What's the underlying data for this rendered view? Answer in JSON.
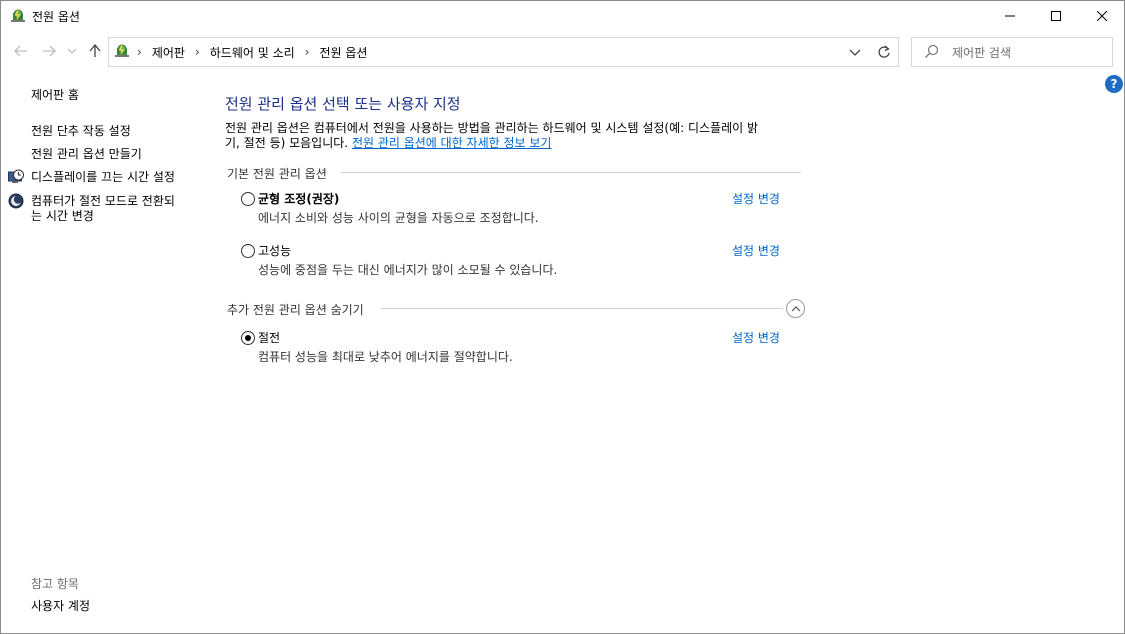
{
  "window": {
    "title": "전원 옵션"
  },
  "address_bar": {
    "crumbs": [
      "제어판",
      "하드웨어 및 소리",
      "전원 옵션"
    ]
  },
  "search": {
    "placeholder": "제어판 검색"
  },
  "help": {
    "label": "?"
  },
  "left_pane": {
    "home": "제어판 홈",
    "links": [
      "전원 단추 작동 설정",
      "전원 관리 옵션 만들기",
      "디스플레이를 끄는 시간 설정",
      "컴퓨터가 절전 모드로 전환되",
      "는 시간 변경"
    ],
    "see_also_heading": "참고 항목",
    "see_also_link": "사용자 계정"
  },
  "main": {
    "title": "전원 관리 옵션 선택 또는 사용자 지정",
    "description_line1": "전원 관리 옵션은 컴퓨터에서 전원을 사용하는 방법을 관리하는 하드웨어 및 시스템 설정(예: 디스플레이 밝",
    "description_line2_prefix": "기, 절전 등) 모음입니다. ",
    "description_link": "전원 관리 옵션에 대한 자세한 정보 보기",
    "section_preferred": "기본 전원 관리 옵션",
    "section_additional": "추가 전원 관리 옵션 숨기기",
    "change_label": "설정 변경",
    "plans": [
      {
        "name": "균형 조정(권장)",
        "description": "에너지 소비와 성능 사이의 균형을 자동으로 조정합니다.",
        "selected": false
      },
      {
        "name": "고성능",
        "description": "성능에 중점을 두는 대신 에너지가 많이 소모될 수 있습니다.",
        "selected": false
      },
      {
        "name": "절전",
        "description": "컴퓨터 성능을 최대로 낮추어 에너지를 절약합니다.",
        "selected": true
      }
    ]
  },
  "colors": {
    "title_blue": "#1e3287",
    "link_blue": "#0066cc",
    "help_blue": "#1f6cc6"
  }
}
